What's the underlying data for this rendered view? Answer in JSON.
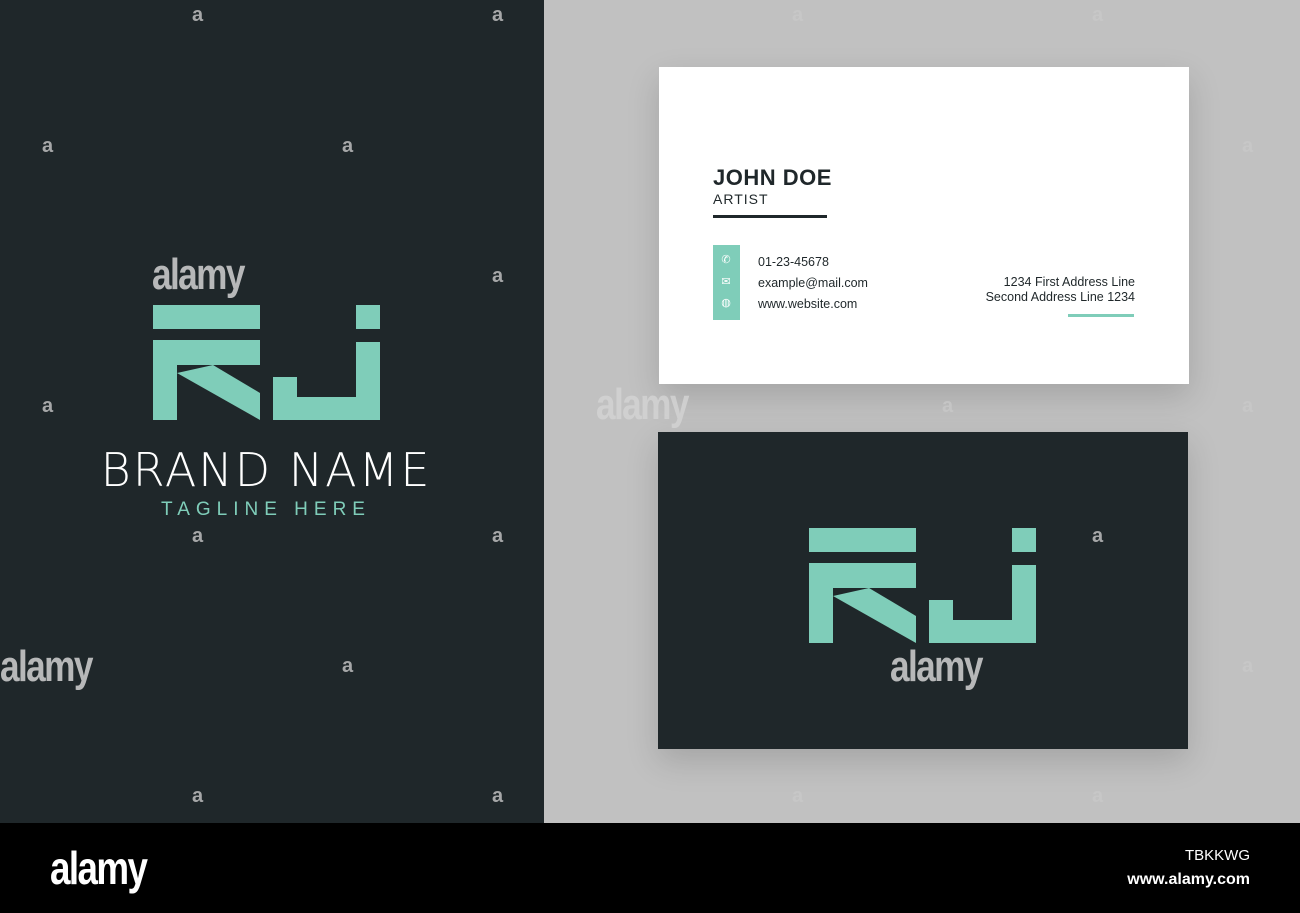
{
  "brand": {
    "name": "BRAND NAME",
    "tagline": "TAGLINE HERE",
    "monogram": "RJ"
  },
  "card_front": {
    "name": "JOHN DOE",
    "role": "ARTIST",
    "phone": "01-23-45678",
    "email": "example@mail.com",
    "website": "www.website.com",
    "address_line1": "1234 First Address Line",
    "address_line2": "Second Address Line 1234"
  },
  "icons": [
    "phone-icon",
    "mail-icon",
    "globe-icon"
  ],
  "colors": {
    "dark": "#1f272a",
    "accent": "#7fcdb9",
    "background": "#c1c1c1"
  },
  "watermark": {
    "text": "alamy",
    "small": "a"
  },
  "footer": {
    "logo": "alamy",
    "image_id": "TBKKWG",
    "url": "www.alamy.com"
  }
}
